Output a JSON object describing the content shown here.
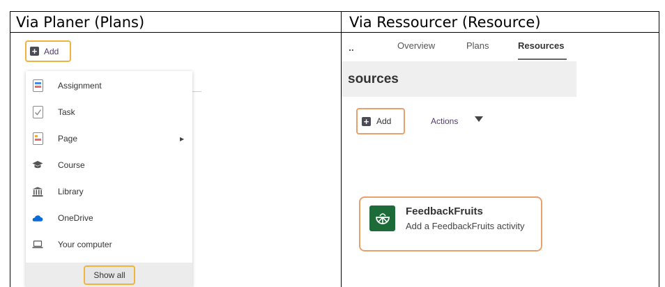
{
  "headers": {
    "left": "Via Planer (Plans)",
    "right": "Via Ressourcer (Resource)"
  },
  "left_panel": {
    "add_label": "Add",
    "menu_items": [
      {
        "label": "Assignment",
        "icon": "assignment-icon"
      },
      {
        "label": "Task",
        "icon": "task-icon"
      },
      {
        "label": "Page",
        "icon": "page-icon",
        "has_submenu": true
      },
      {
        "label": "Course",
        "icon": "course-icon"
      },
      {
        "label": "Library",
        "icon": "library-icon"
      },
      {
        "label": "OneDrive",
        "icon": "onedrive-icon"
      },
      {
        "label": "Your computer",
        "icon": "laptop-icon"
      }
    ],
    "show_all_label": "Show all"
  },
  "right_panel": {
    "breadcrumb_dots": "..",
    "tabs": [
      {
        "label": "Overview",
        "active": false
      },
      {
        "label": "Plans",
        "active": false
      },
      {
        "label": "Resources",
        "active": true
      }
    ],
    "page_title": "sources",
    "add_label": "Add",
    "actions_label": "Actions",
    "feedbackfruits": {
      "title": "FeedbackFruits",
      "subtitle": "Add a FeedbackFruits activity"
    }
  },
  "colors": {
    "highlight_left": "#f0b33e",
    "highlight_right": "#e9a06a",
    "feedbackfruits_green": "#1e6b3a",
    "accent_purple": "#4f3a6b"
  }
}
